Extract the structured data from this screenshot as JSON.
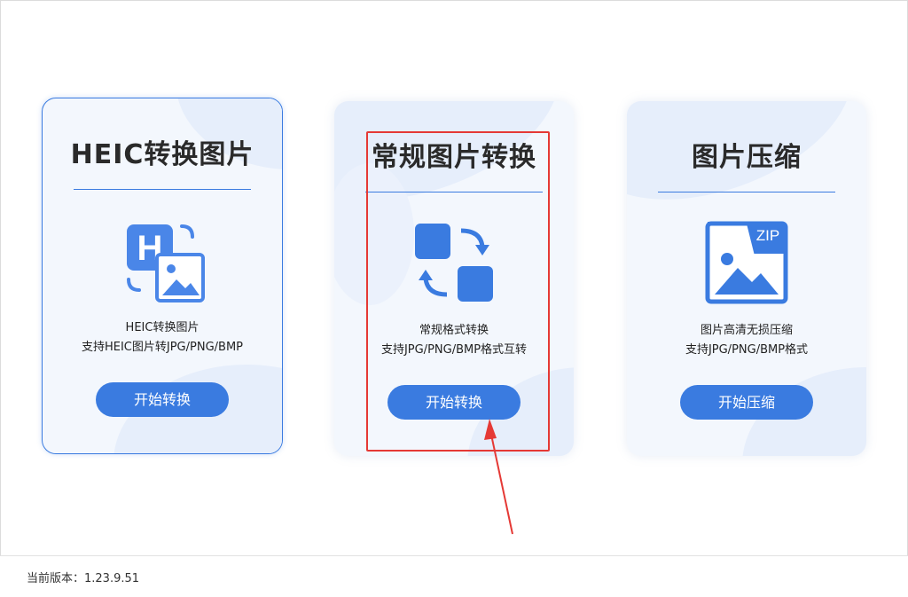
{
  "colors": {
    "accent": "#3a7be0",
    "highlight": "#e53935",
    "card_bg": "#f3f7fd"
  },
  "cards": [
    {
      "title": "HEIC转换图片",
      "desc_line1": "HEIC转换图片",
      "desc_line2": "支持HEIC图片转JPG/PNG/BMP",
      "button": "开始转换",
      "icon": "heic-image-icon"
    },
    {
      "title": "常规图片转换",
      "desc_line1": "常规格式转换",
      "desc_line2": "支持JPG/PNG/BMP格式互转",
      "button": "开始转换",
      "icon": "convert-arrows-icon"
    },
    {
      "title": "图片压缩",
      "desc_line1": "图片高清无损压缩",
      "desc_line2": "支持JPG/PNG/BMP格式",
      "button": "开始压缩",
      "icon": "zip-image-icon",
      "icon_badge": "ZIP"
    }
  ],
  "footer": {
    "version_label": "当前版本：1.23.9.51"
  }
}
